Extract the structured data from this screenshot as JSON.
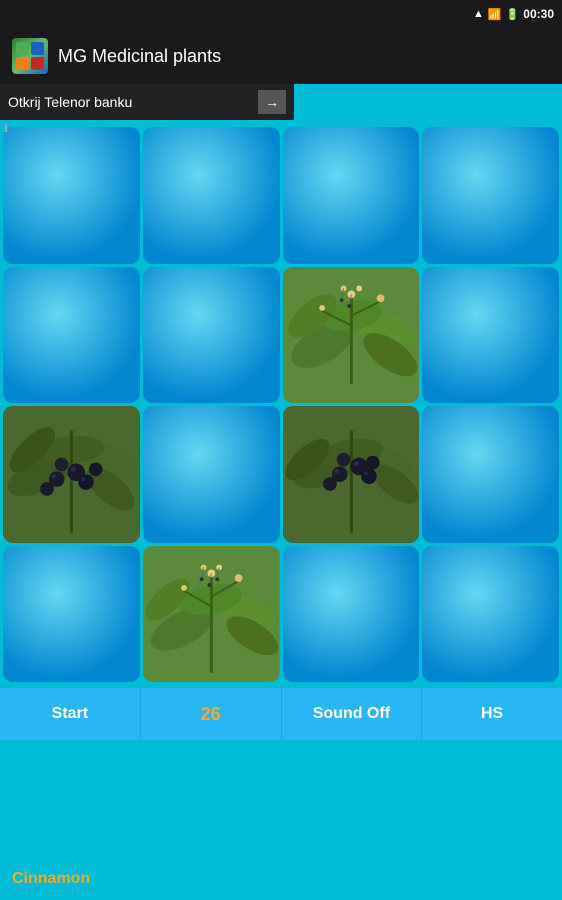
{
  "statusBar": {
    "time": "00:30",
    "icons": [
      "signal",
      "wifi",
      "battery"
    ]
  },
  "header": {
    "appTitle": "MG Medicinal plants",
    "iconAlt": "app-icon"
  },
  "adBanner": {
    "text": "Otkrij Telenor banku",
    "arrowLabel": "→"
  },
  "grid": {
    "rows": 4,
    "cols": 4,
    "tiles": [
      {
        "id": 0,
        "type": "blue"
      },
      {
        "id": 1,
        "type": "blue"
      },
      {
        "id": 2,
        "type": "blue"
      },
      {
        "id": 3,
        "type": "blue"
      },
      {
        "id": 4,
        "type": "blue"
      },
      {
        "id": 5,
        "type": "blue"
      },
      {
        "id": 6,
        "type": "flowers"
      },
      {
        "id": 7,
        "type": "blue"
      },
      {
        "id": 8,
        "type": "berries"
      },
      {
        "id": 9,
        "type": "blue"
      },
      {
        "id": 10,
        "type": "berries2"
      },
      {
        "id": 11,
        "type": "blue"
      },
      {
        "id": 12,
        "type": "blue"
      },
      {
        "id": 13,
        "type": "flowers2"
      },
      {
        "id": 14,
        "type": "blue"
      },
      {
        "id": 15,
        "type": "blue"
      }
    ]
  },
  "toolbar": {
    "startLabel": "Start",
    "scoreValue": "26",
    "soundLabel": "Sound Off",
    "hsLabel": "HS"
  },
  "footer": {
    "plantName": "Cinnamon"
  }
}
